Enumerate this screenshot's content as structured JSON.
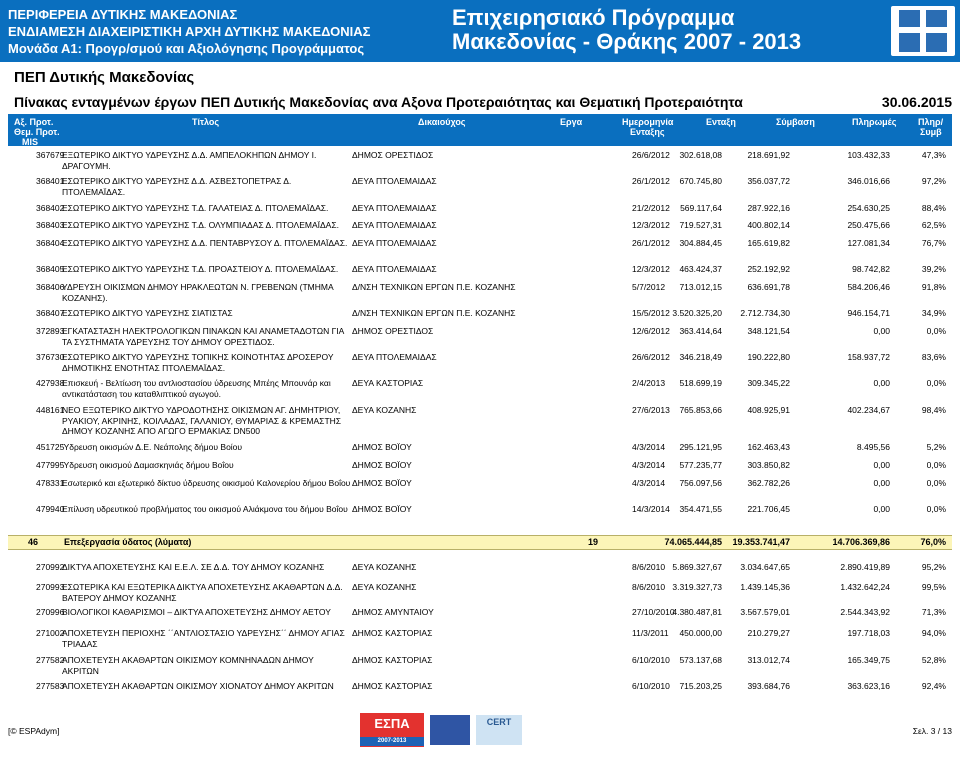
{
  "banner": {
    "left_line1": "ΠΕΡΙΦΕΡΕΙΑ ΔΥΤΙΚΗΣ ΜΑΚΕΔΟΝΙΑΣ",
    "left_line2": "ΕΝΔΙΑΜΕΣΗ ΔΙΑΧΕΙΡΙΣΤΙΚΗ ΑΡΧΗ ΔΥΤΙΚΗΣ ΜΑΚΕΔΟΝΙΑΣ",
    "left_line3": "Μονάδα Α1: Προγρ/σμού και Αξιολόγησης Προγράμματος",
    "right_line1": "Επιχειρησιακό Πρόγραμμα",
    "right_line2": "Μακεδονίας - Θράκης 2007 - 2013"
  },
  "pep_title": "ΠΕΠ Δυτικής Μακεδονίας",
  "subtitle": "Πίνακας ενταγμένων έργων ΠΕΠ Δυτικής Μακεδονίας ανα Αξονα Προτεραιότητας και Θεματική Προτεραιότητα",
  "date": "30.06.2015",
  "header": {
    "ax_prot": "Αξ. Προτ.",
    "them_prot": "Θεμ. Προτ.",
    "mis": "MIS",
    "title": "Τίτλος",
    "beneficiary": "Δικαιούχος",
    "erga": "Εργα",
    "date_line1": "Ημερομηνία",
    "date_line2": "Ενταξης",
    "entaxi": "Ενταξη",
    "symbasi": "Σύμβαση",
    "plirwmes": "Πληρωμές",
    "plir_line1": "Πληρ/",
    "plir_line2": "Συμβ"
  },
  "rows": [
    {
      "mis": "367679",
      "title": "ΕΞΩΤΕΡΙΚΟ ΔΙΚΤΥΟ ΥΔΡΕΥΣΗΣ Δ.Δ. ΑΜΠΕΛΟΚΗΠΩΝ ΔΗΜΟΥ Ι. ΔΡΑΓΟΥΜΗ.",
      "ben": "ΔΗΜΟΣ ΟΡΕΣΤΙΔΟΣ",
      "date": "26/6/2012",
      "entaxi": "302.618,08",
      "symbasi": "218.691,92",
      "plir": "103.432,33",
      "pct": "47,3%"
    },
    {
      "mis": "368401",
      "title": "ΕΣΩΤΕΡΙΚΟ ΔΙΚΤΥΟ ΥΔΡΕΥΣΗΣ Δ.Δ. ΑΣΒΕΣΤΟΠΕΤΡΑΣ Δ. ΠΤΟΛΕΜΑΪΔΑΣ.",
      "ben": "ΔΕΥΑ ΠΤΟΛΕΜΑΙΔΑΣ",
      "date": "26/1/2012",
      "entaxi": "670.745,80",
      "symbasi": "356.037,72",
      "plir": "346.016,66",
      "pct": "97,2%"
    },
    {
      "mis": "368402",
      "title": "ΕΣΩΤΕΡΙΚΟ ΔΙΚΤΥΟ ΥΔΡΕΥΣΗΣ Τ.Δ. ΓΑΛΑΤΕΙΑΣ Δ. ΠΤΟΛΕΜΑΪΔΑΣ.",
      "ben": "ΔΕΥΑ ΠΤΟΛΕΜΑΙΔΑΣ",
      "date": "21/2/2012",
      "entaxi": "569.117,64",
      "symbasi": "287.922,16",
      "plir": "254.630,25",
      "pct": "88,4%"
    },
    {
      "mis": "368403",
      "title": "ΕΣΩΤΕΡΙΚΟ ΔΙΚΤΥΟ ΥΔΡΕΥΣΗΣ Τ.Δ. ΟΛΥΜΠΙΑΔΑΣ Δ. ΠΤΟΛΕΜΑΪΔΑΣ.",
      "ben": "ΔΕΥΑ ΠΤΟΛΕΜΑΙΔΑΣ",
      "date": "12/3/2012",
      "entaxi": "719.527,31",
      "symbasi": "400.802,14",
      "plir": "250.475,66",
      "pct": "62,5%"
    },
    {
      "mis": "368404",
      "title": "ΕΣΩΤΕΡΙΚΟ ΔΙΚΤΥΟ ΥΔΡΕΥΣΗΣ Δ.Δ. ΠΕΝΤΑΒΡΥΣΟΥ Δ. ΠΤΟΛΕΜΑΪΔΑΣ.",
      "ben": "ΔΕΥΑ ΠΤΟΛΕΜΑΙΔΑΣ",
      "date": "26/1/2012",
      "entaxi": "304.884,45",
      "symbasi": "165.619,82",
      "plir": "127.081,34",
      "pct": "76,7%"
    },
    {
      "mis": "368405",
      "title": "ΕΣΩΤΕΡΙΚΟ ΔΙΚΤΥΟ ΥΔΡΕΥΣΗΣ Τ.Δ. ΠΡΟΑΣΤΕΙΟΥ Δ. ΠΤΟΛΕΜΑΪΔΑΣ.",
      "ben": "ΔΕΥΑ ΠΤΟΛΕΜΑΙΔΑΣ",
      "date": "12/3/2012",
      "entaxi": "463.424,37",
      "symbasi": "252.192,92",
      "plir": "98.742,82",
      "pct": "39,2%"
    },
    {
      "mis": "368406",
      "title": "ΥΔΡΕΥΣΗ ΟΙΚΙΣΜΩΝ ΔΗΜΟΥ ΗΡΑΚΛΕΩΤΩΝ Ν. ΓΡΕΒΕΝΩΝ (ΤΜΗΜΑ ΚΟΖΑΝΗΣ).",
      "ben": "Δ/ΝΣΗ ΤΕΧΝΙΚΩΝ ΕΡΓΩΝ Π.Ε. ΚΟΖΑΝΗΣ",
      "date": "5/7/2012",
      "entaxi": "713.012,15",
      "symbasi": "636.691,78",
      "plir": "584.206,46",
      "pct": "91,8%"
    },
    {
      "mis": "368407",
      "title": "ΕΣΩΤΕΡΙΚΟ ΔΙΚΤΥΟ ΥΔΡΕΥΣΗΣ ΣΙΑΤΙΣΤΑΣ",
      "ben": "Δ/ΝΣΗ ΤΕΧΝΙΚΩΝ ΕΡΓΩΝ Π.Ε. ΚΟΖΑΝΗΣ",
      "date": "15/5/2012",
      "entaxi": "3.520.325,20",
      "symbasi": "2.712.734,30",
      "plir": "946.154,71",
      "pct": "34,9%"
    },
    {
      "mis": "372893",
      "title": "ΕΓΚΑΤΑΣΤΑΣΗ ΗΛΕΚΤΡΟΛΟΓΙΚΩΝ ΠΙΝΑΚΩΝ ΚΑΙ ΑΝΑΜΕΤΑΔΟΤΩΝ ΓΙΑ ΤΑ ΣΥΣΤΗΜΑΤΑ ΥΔΡΕΥΣΗΣ ΤΟΥ ΔΗΜΟΥ ΟΡΕΣΤΙΔΟΣ.",
      "ben": "ΔΗΜΟΣ ΟΡΕΣΤΙΔΟΣ",
      "date": "12/6/2012",
      "entaxi": "363.414,64",
      "symbasi": "348.121,54",
      "plir": "0,00",
      "pct": "0,0%"
    },
    {
      "mis": "376730",
      "title": "ΕΣΩΤΕΡΙΚΟ ΔΙΚΤΥΟ ΥΔΡΕΥΣΗΣ ΤΟΠΙΚΗΣ ΚΟΙΝΟΤΗΤΑΣ ΔΡΟΣΕΡΟΥ ΔΗΜΟΤΙΚΗΣ ΕΝΟΤΗΤΑΣ ΠΤΟΛΕΜΑΪΔΑΣ.",
      "ben": "ΔΕΥΑ ΠΤΟΛΕΜΑΙΔΑΣ",
      "date": "26/6/2012",
      "entaxi": "346.218,49",
      "symbasi": "190.222,80",
      "plir": "158.937,72",
      "pct": "83,6%"
    },
    {
      "mis": "427938",
      "title": "Επισκευή - Βελτίωση του αντλιοστασίου ύδρευσης Μπέης Μπουνάρ και αντικατάσταση του καταθλιπτικού αγωγού.",
      "ben": "ΔΕΥΑ ΚΑΣΤΟΡΙΑΣ",
      "date": "2/4/2013",
      "entaxi": "518.699,19",
      "symbasi": "309.345,22",
      "plir": "0,00",
      "pct": "0,0%"
    },
    {
      "mis": "448161",
      "title": "ΝΕΟ ΕΞΩΤΕΡΙΚΟ ΔΙΚΤΥΟ ΥΔΡΟΔΟΤΗΣΗΣ ΟΙΚΙΣΜΩΝ ΑΓ. ΔΗΜΗΤΡΙΟΥ, ΡΥΑΚΙΟΥ, ΑΚΡΙΝΗΣ, ΚΟΙΛΑΔΑΣ, ΓΑΛΑΝΙΟΥ, ΘΥΜΑΡΙΑΣ & ΚΡΕΜΑΣΤΗΣ ΔΗΜΟΥ ΚΟΖΑΝΗΣ ΑΠΟ ΑΓΩΓΟ ΕΡΜΑΚΙΑΣ DN500",
      "ben": "ΔΕΥΑ ΚΟΖΑΝΗΣ",
      "date": "27/6/2013",
      "entaxi": "765.853,66",
      "symbasi": "408.925,91",
      "plir": "402.234,67",
      "pct": "98,4%"
    },
    {
      "mis": "451725",
      "title": "Ύδρευση οικισμών Δ.Ε. Νεάπολης δήμου Βοίου",
      "ben": "ΔΗΜΟΣ ΒΟΪΟΥ",
      "date": "4/3/2014",
      "entaxi": "295.121,95",
      "symbasi": "162.463,43",
      "plir": "8.495,56",
      "pct": "5,2%"
    },
    {
      "mis": "477995",
      "title": "Ύδρευση οικισμού Δαμασκηνιάς δήμου Βοΐου",
      "ben": "ΔΗΜΟΣ ΒΟΪΟΥ",
      "date": "4/3/2014",
      "entaxi": "577.235,77",
      "symbasi": "303.850,82",
      "plir": "0,00",
      "pct": "0,0%"
    },
    {
      "mis": "478331",
      "title": "Εσωτερικό και εξωτερικό δίκτυο ύδρευσης οικισμού Καλονερίου δήμου Βοΐου",
      "ben": "ΔΗΜΟΣ ΒΟΪΟΥ",
      "date": "4/3/2014",
      "entaxi": "756.097,56",
      "symbasi": "362.782,26",
      "plir": "0,00",
      "pct": "0,0%"
    },
    {
      "mis": "479940",
      "title": "Επίλυση υδρευτικού προβλήματος του οικισμού Αλιάκμονα του δήμου Βοΐου",
      "ben": "ΔΗΜΟΣ ΒΟΪΟΥ",
      "date": "14/3/2014",
      "entaxi": "354.471,55",
      "symbasi": "221.706,45",
      "plir": "0,00",
      "pct": "0,0%"
    }
  ],
  "summary": {
    "code": "46",
    "label": "Επεξεργασία ύδατος (λύματα)",
    "erga": "19",
    "entaxi": "74.065.444,85",
    "symbasi": "19.353.741,47",
    "plir": "14.706.369,86",
    "pct": "76,0%"
  },
  "rows2": [
    {
      "mis": "270992",
      "title": "ΔΙΚΤΥΑ ΑΠΟΧΕΤΕΥΣΗΣ ΚΑΙ Ε.Ε.Λ. ΣΕ Δ.Δ. ΤΟΥ ΔΗΜΟΥ ΚΟΖΑΝΗΣ",
      "ben": "ΔΕΥΑ ΚΟΖΑΝΗΣ",
      "date": "8/6/2010",
      "entaxi": "5.869.327,67",
      "symbasi": "3.034.647,65",
      "plir": "2.890.419,89",
      "pct": "95,2%"
    },
    {
      "mis": "270993",
      "title": "ΕΣΩΤΕΡΙΚΑ ΚΑΙ ΕΞΩΤΕΡΙΚΑ ΔΙΚΤΥΑ ΑΠΟΧΕΤΕΥΣΗΣ ΑΚΑΘΑΡΤΩΝ Δ.Δ. ΒΑΤΕΡΟΥ ΔΗΜΟΥ ΚΟΖΑΝΗΣ",
      "ben": "ΔΕΥΑ ΚΟΖΑΝΗΣ",
      "date": "8/6/2010",
      "entaxi": "3.319.327,73",
      "symbasi": "1.439.145,36",
      "plir": "1.432.642,24",
      "pct": "99,5%"
    },
    {
      "mis": "270996",
      "title": "ΒΙΟΛΟΓΙΚΟΙ ΚΑΘΑΡΙΣΜΟΙ – ΔΙΚΤΥΑ ΑΠΟΧΕΤΕΥΣΗΣ ΔΗΜΟΥ ΑΕΤΟΥ",
      "ben": "ΔΗΜΟΣ ΑΜΥΝΤΑΙΟΥ",
      "date": "27/10/2010",
      "entaxi": "4.380.487,81",
      "symbasi": "3.567.579,01",
      "plir": "2.544.343,92",
      "pct": "71,3%"
    },
    {
      "mis": "271002",
      "title": "ΑΠΟΧΕΤΕΥΣΗ ΠΕΡΙΟΧΗΣ ΄΄ΑΝΤΛΙΟΣΤΑΣΙΟ ΥΔΡΕΥΣΗΣ΄΄ ΔΗΜΟΥ ΑΓΙΑΣ ΤΡΙΑΔΑΣ",
      "ben": "ΔΗΜΟΣ ΚΑΣΤΟΡΙΑΣ",
      "date": "11/3/2011",
      "entaxi": "450.000,00",
      "symbasi": "210.279,27",
      "plir": "197.718,03",
      "pct": "94,0%"
    },
    {
      "mis": "277582",
      "title": "ΑΠΟΧΕΤΕΥΣΗ ΑΚΑΘΑΡΤΩΝ ΟΙΚΙΣΜΟΥ ΚΟΜΝΗΝΑΔΩΝ ΔΗΜΟΥ ΑΚΡΙΤΩΝ",
      "ben": "ΔΗΜΟΣ ΚΑΣΤΟΡΙΑΣ",
      "date": "6/10/2010",
      "entaxi": "573.137,68",
      "symbasi": "313.012,74",
      "plir": "165.349,75",
      "pct": "52,8%"
    },
    {
      "mis": "277583",
      "title": "ΑΠΟΧΕΤΕΥΣΗ ΑΚΑΘΑΡΤΩΝ ΟΙΚΙΣΜΟΥ ΧΙΟΝΑΤΟΥ ΔΗΜΟΥ ΑΚΡΙΤΩΝ",
      "ben": "ΔΗΜΟΣ ΚΑΣΤΟΡΙΑΣ",
      "date": "6/10/2010",
      "entaxi": "715.203,25",
      "symbasi": "393.684,76",
      "plir": "363.623,16",
      "pct": "92,4%"
    }
  ],
  "footer": {
    "left": "[© ESPAdym]",
    "right": "Σελ. 3 / 13",
    "espa_logo_text": "ΕΣΠΑ",
    "espa_logo_years": "2007-2013",
    "cert_logo_text": "CERT"
  }
}
